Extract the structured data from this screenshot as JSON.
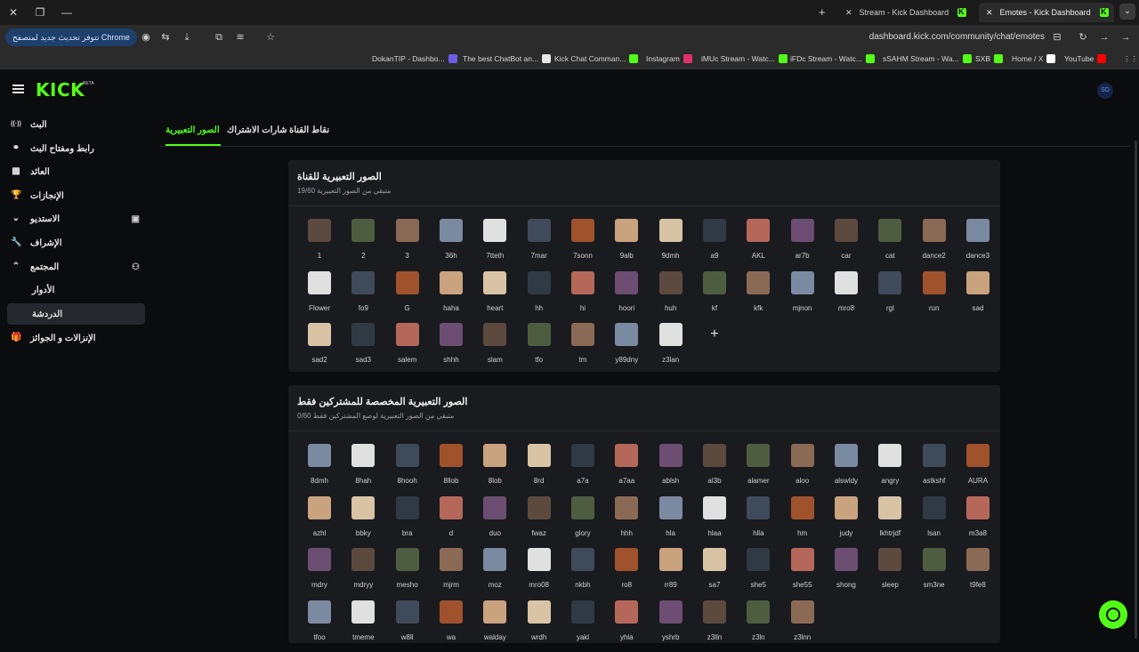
{
  "browser": {
    "tabs": [
      {
        "title": "Stream - Kick Dashboard",
        "active": false
      },
      {
        "title": "Emotes - Kick Dashboard",
        "active": true
      }
    ],
    "update_pill": "تتوفر تحديث جديد لمتصفح Chrome",
    "url": "dashboard.kick.com/community/chat/emotes",
    "bookmarks": [
      {
        "label": "DokanTIP - Dashbo...",
        "color": "#6c5ce7"
      },
      {
        "label": "The best ChatBot an...",
        "color": "#e6e6e6"
      },
      {
        "label": "Kick Chat Comman...",
        "color": "#53fc18"
      },
      {
        "label": "Instagram",
        "color": "#e1306c"
      },
      {
        "label": "iMUc Stream - Watc...",
        "color": "#53fc18"
      },
      {
        "label": "iFDc Stream - Watc...",
        "color": "#53fc18"
      },
      {
        "label": "sSAHM Stream - Wa...",
        "color": "#53fc18"
      },
      {
        "label": "SXB",
        "color": "#53fc18"
      },
      {
        "label": "Home / X",
        "color": "#ffffff"
      },
      {
        "label": "YouTube",
        "color": "#ff0000"
      }
    ]
  },
  "header": {
    "logo": "KICK",
    "badge": "BETA"
  },
  "sidebar": {
    "items": [
      {
        "label": "البث",
        "icon": "broadcast-icon"
      },
      {
        "label": "رابط ومفتاح البث",
        "icon": "link-icon"
      },
      {
        "label": "العائد",
        "icon": "revenue-icon"
      },
      {
        "label": "الإنجازات",
        "icon": "trophy-icon"
      },
      {
        "label": "الاستديو",
        "icon": "chevron-down-icon"
      },
      {
        "label": "الإشراف",
        "icon": "wrench-icon"
      },
      {
        "label": "المجتمع",
        "icon": "chevron-up-icon"
      },
      {
        "label": "الأدوار",
        "icon": ""
      },
      {
        "label": "الدردشة",
        "icon": ""
      },
      {
        "label": "الإنزالات و الجوائز",
        "icon": "gift-icon"
      }
    ]
  },
  "page_tabs": [
    {
      "label": "الصور التعبيرية",
      "active": true
    },
    {
      "label": "شارات الاشتراك",
      "active": false
    },
    {
      "label": "نقاط القناة",
      "active": false
    }
  ],
  "channel_emotes": {
    "title": "الصور التعبيرية للقناة",
    "subtitle": "متبقي من الصور التعبيرية 19/60",
    "items": [
      "1",
      "2",
      "3",
      "36h",
      "7tteth",
      "7mar",
      "7sonn",
      "9alb",
      "9dmh",
      "a9",
      "AKL",
      "ar7b",
      "car",
      "cat",
      "dance2",
      "dance3",
      "Flower",
      "fo9",
      "G",
      "haha",
      "heart",
      "hh",
      "hi",
      "hoori",
      "huh",
      "kf",
      "kfk",
      "mjnon",
      "mro8",
      "rgl",
      "run",
      "sad",
      "sad2",
      "sad3",
      "salem",
      "shhh",
      "slam",
      "tfo",
      "tm",
      "y89dny",
      "z3lan"
    ]
  },
  "subscriber_emotes": {
    "title": "الصور التعبيرية المخصصة للمشتركين فقط",
    "subtitle": "متبقي من الصور التعبيرية لوضع المشتركين فقط 0/60",
    "items": [
      "8dmh",
      "8hah",
      "8hooh",
      "8llob",
      "8lob",
      "8rd",
      "a7a",
      "a7aa",
      "ablsh",
      "al3b",
      "alamer",
      "aloo",
      "alswldy",
      "angry",
      "astkshf",
      "AURA",
      "azhl",
      "bbky",
      "bra",
      "d",
      "duo",
      "fwaz",
      "glory",
      "hhh",
      "hla",
      "hlaa",
      "hlla",
      "hm",
      "judy",
      "lkhtrjdf",
      "lsan",
      "m3a8",
      "mdry",
      "mdryy",
      "mesho",
      "mjrm",
      "moz",
      "mro08",
      "nkbh",
      "ro8",
      "rr89",
      "sa7",
      "she5",
      "she55",
      "shong",
      "sleep",
      "sm3ne",
      "t9fe8",
      "tfoo",
      "tmeme",
      "w8ll",
      "wa",
      "walday",
      "wrdh",
      "yakl",
      "yhla",
      "yshrb",
      "z3lln",
      "z3ln",
      "z3lnn"
    ]
  }
}
